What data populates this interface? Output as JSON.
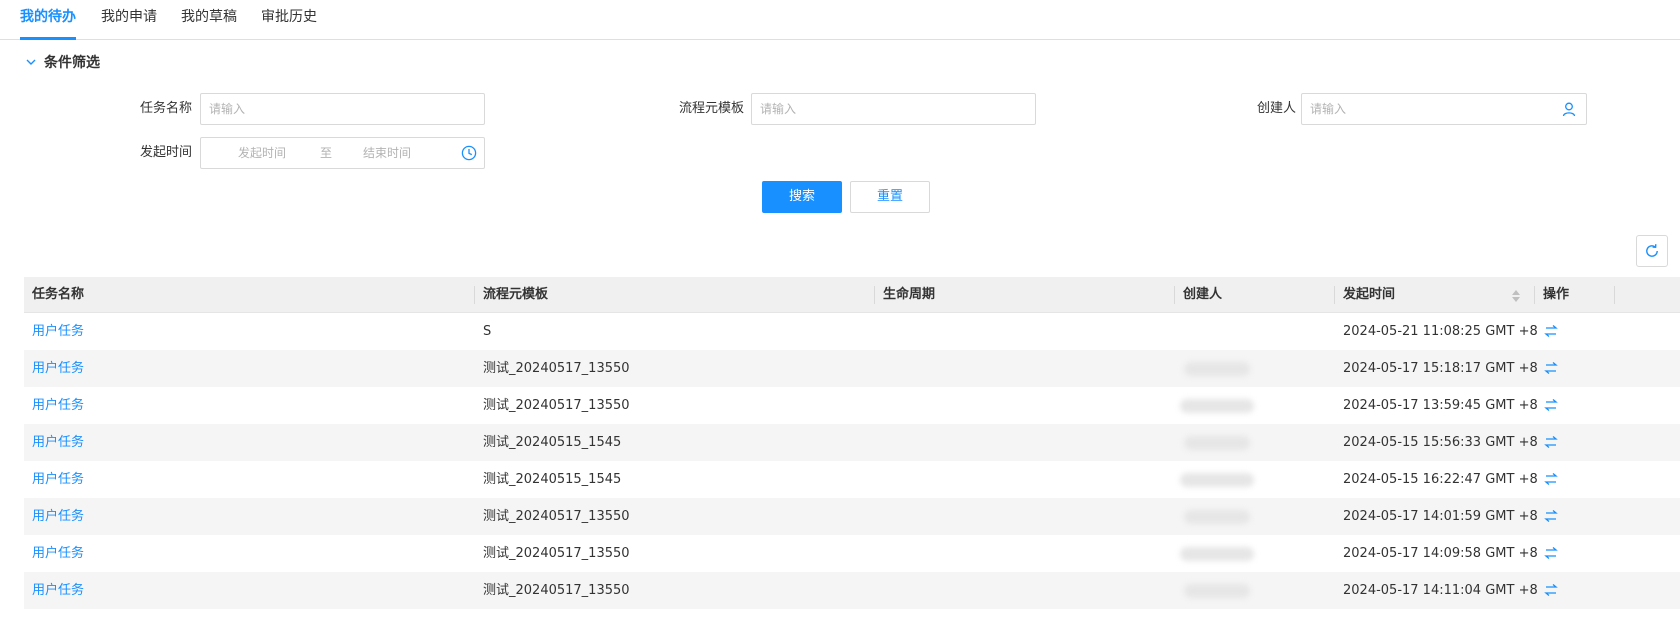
{
  "tabs": [
    {
      "label": "我的待办",
      "active": true
    },
    {
      "label": "我的申请",
      "active": false
    },
    {
      "label": "我的草稿",
      "active": false
    },
    {
      "label": "审批历史",
      "active": false
    }
  ],
  "filter": {
    "title": "条件筛选",
    "task_name_label": "任务名称",
    "task_name_placeholder": "请输入",
    "template_label": "流程元模板",
    "template_placeholder": "请输入",
    "creator_label": "创建人",
    "creator_placeholder": "请输入",
    "start_time_label": "发起时间",
    "start_placeholder": "发起时间",
    "range_separator": "至",
    "end_placeholder": "结束时间",
    "search_label": "搜索",
    "reset_label": "重置"
  },
  "table": {
    "columns": [
      "任务名称",
      "流程元模板",
      "生命周期",
      "创建人",
      "发起时间",
      "操作"
    ],
    "rows": [
      {
        "task": "用户任务",
        "template": "S",
        "lifecycle": "",
        "creator_hidden": false,
        "time": "2024-05-21 11:08:25 GMT +8"
      },
      {
        "task": "用户任务",
        "template": "测试_20240517_13550",
        "lifecycle": "",
        "creator_hidden": true,
        "time": "2024-05-17 15:18:17 GMT +8"
      },
      {
        "task": "用户任务",
        "template": "测试_20240517_13550",
        "lifecycle": "",
        "creator_hidden": true,
        "time": "2024-05-17 13:59:45 GMT +8"
      },
      {
        "task": "用户任务",
        "template": "测试_20240515_1545",
        "lifecycle": "",
        "creator_hidden": true,
        "time": "2024-05-15 15:56:33 GMT +8"
      },
      {
        "task": "用户任务",
        "template": "测试_20240515_1545",
        "lifecycle": "",
        "creator_hidden": true,
        "time": "2024-05-15 16:22:47 GMT +8"
      },
      {
        "task": "用户任务",
        "template": "测试_20240517_13550",
        "lifecycle": "",
        "creator_hidden": true,
        "time": "2024-05-17 14:01:59 GMT +8"
      },
      {
        "task": "用户任务",
        "template": "测试_20240517_13550",
        "lifecycle": "",
        "creator_hidden": true,
        "time": "2024-05-17 14:09:58 GMT +8"
      },
      {
        "task": "用户任务",
        "template": "测试_20240517_13550",
        "lifecycle": "",
        "creator_hidden": true,
        "time": "2024-05-17 14:11:04 GMT +8"
      }
    ]
  },
  "icons": {
    "collapse": "chevron-down-icon",
    "creator_picker": "user-icon",
    "date_picker": "clock-icon",
    "refresh": "refresh-icon",
    "sort": "sort-icon",
    "row_action": "transfer-icon"
  },
  "colors": {
    "accent": "#1890ff",
    "header_bg": "#f0f0f0",
    "stripe_bg": "#f5f5f5"
  }
}
